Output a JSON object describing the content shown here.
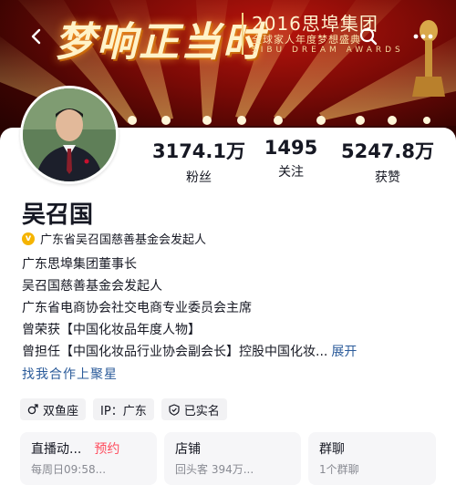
{
  "banner": {
    "big_title": "梦响正当时",
    "year_title": "2016思埠集团",
    "sub_title": "全球家人年度梦想盛典",
    "en_title": "SIBU DREAM AWARDS"
  },
  "nav": {
    "back_icon": "chevron-left-icon",
    "search_icon": "search-icon",
    "more_icon": "more-dots-icon"
  },
  "profile": {
    "name": "吴召国",
    "verified_text": "广东省吴召国慈善基金会发起人",
    "stats": [
      {
        "value": "3174.1万",
        "label": "粉丝"
      },
      {
        "value": "1495",
        "label": "关注"
      },
      {
        "value": "5247.8万",
        "label": "获赞"
      }
    ],
    "bio_lines": [
      "广东思埠集团董事长",
      "吴召国慈善基金会发起人",
      "广东省电商协会社交电商专业委员会主席",
      "曾荣获【中国化妆品年度人物】",
      "曾担任【中国化妆品行业协会副会长】控股中国化妆"
    ],
    "bio_ellipsis": "...",
    "expand_label": "展开",
    "link_text": "找我合作上聚星",
    "tags": [
      {
        "icon": "male-icon",
        "text": "双鱼座"
      },
      {
        "icon": "",
        "text": "IP：广东"
      },
      {
        "icon": "shield-check-icon",
        "text": "已实名"
      }
    ]
  },
  "shortcuts": [
    {
      "title": "直播动...",
      "highlight": "预约",
      "desc": "每周日09:58..."
    },
    {
      "title": "店铺",
      "highlight": "",
      "desc": "回头客 394万..."
    },
    {
      "title": "群聊",
      "highlight": "",
      "desc": "1个群聊"
    }
  ],
  "colors": {
    "link": "#2b5b9a",
    "highlight": "#ff4d5e",
    "verify_badge": "#f5b400"
  }
}
